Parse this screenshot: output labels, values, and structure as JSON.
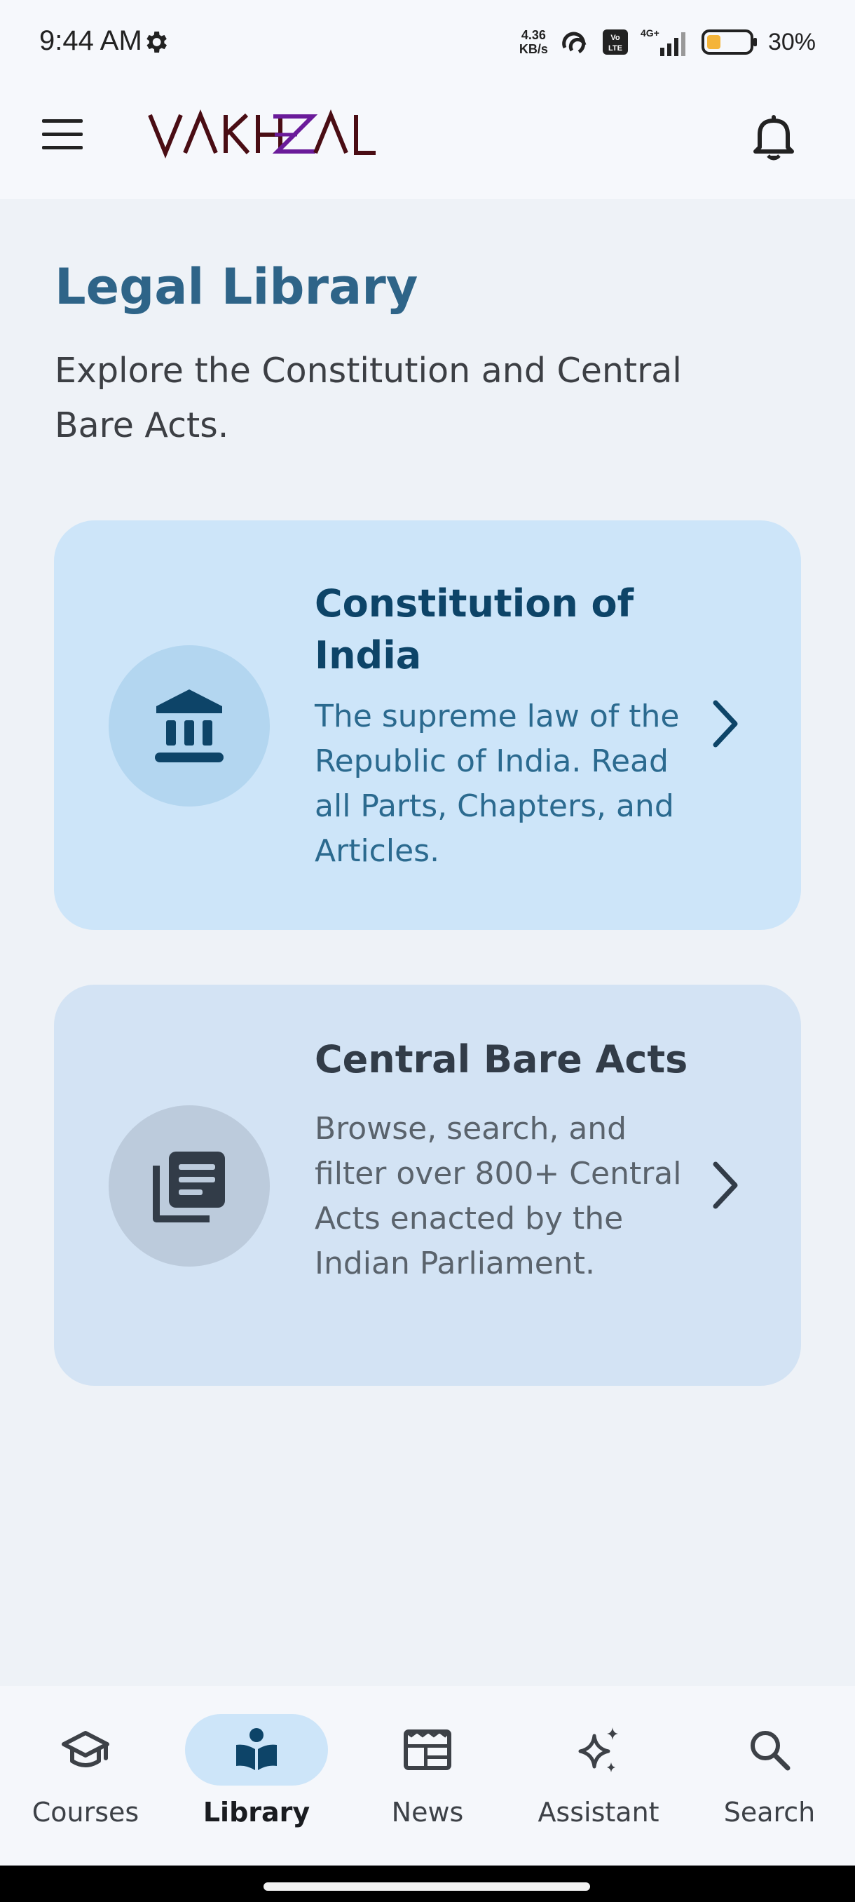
{
  "status_bar": {
    "time": "9:44 AM",
    "net_speed_value": "4.36",
    "net_speed_unit": "KB/s",
    "network_label": "4G+",
    "volte_label": "Vo LTE",
    "battery_percent": "30%",
    "battery_level": 0.3
  },
  "app_bar": {
    "logo_text": "VAKHZAL",
    "icons": [
      "menu-icon",
      "bell-icon"
    ]
  },
  "page": {
    "title": "Legal Library",
    "subtitle": "Explore the Constitution and Central Bare Acts."
  },
  "cards": [
    {
      "title": "Constitution of India",
      "description": "The supreme law of the Republic of India. Read all Parts, Chapters, and Articles.",
      "icon": "institution-icon"
    },
    {
      "title": "Central Bare Acts",
      "description": "Browse, search, and filter over 800+ Central Acts enacted by the Indian Parliament.",
      "icon": "documents-icon"
    }
  ],
  "bottom_nav": {
    "items": [
      {
        "label": "Courses",
        "icon": "graduation-cap-icon",
        "active": false
      },
      {
        "label": "Library",
        "icon": "book-reader-icon",
        "active": true
      },
      {
        "label": "News",
        "icon": "newspaper-icon",
        "active": false
      },
      {
        "label": "Assistant",
        "icon": "sparkle-icon",
        "active": false
      },
      {
        "label": "Search",
        "icon": "search-icon",
        "active": false
      }
    ]
  },
  "colors": {
    "accent": "#2e6488",
    "card_primary": "#cde5f9",
    "card_secondary": "#d3e3f4",
    "logo_primary": "#4a0d14",
    "logo_accent": "#6a1b9a"
  }
}
